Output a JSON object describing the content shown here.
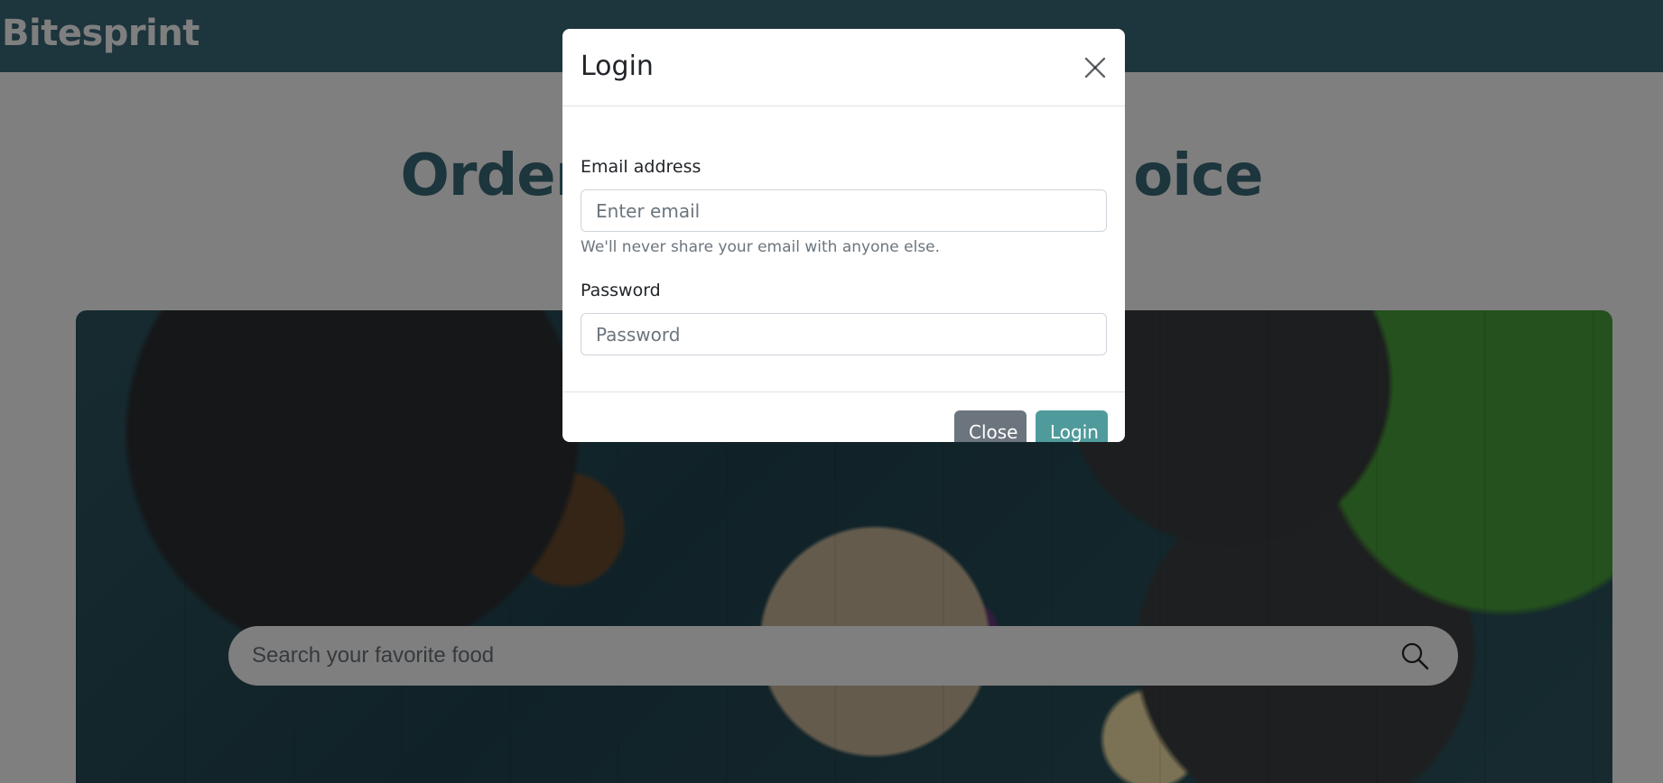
{
  "app": {
    "brand": "Bitesprint"
  },
  "hero": {
    "title_visible_left": "Order",
    "title_visible_right": "oice"
  },
  "search": {
    "placeholder": "Search your favorite food",
    "icon": "search-icon"
  },
  "login_modal": {
    "title": "Login",
    "close_icon": "close-icon",
    "email_label": "Email address",
    "email_placeholder": "Enter email",
    "email_help": "We'll never share your email with anyone else.",
    "password_label": "Password",
    "password_placeholder": "Password",
    "close_button": "Close",
    "login_button": "Login"
  },
  "colors": {
    "navbar": "#3a6b78",
    "accent": "#4f9b9b",
    "secondary": "#6c757d",
    "hero_title": "#3a6b78"
  }
}
